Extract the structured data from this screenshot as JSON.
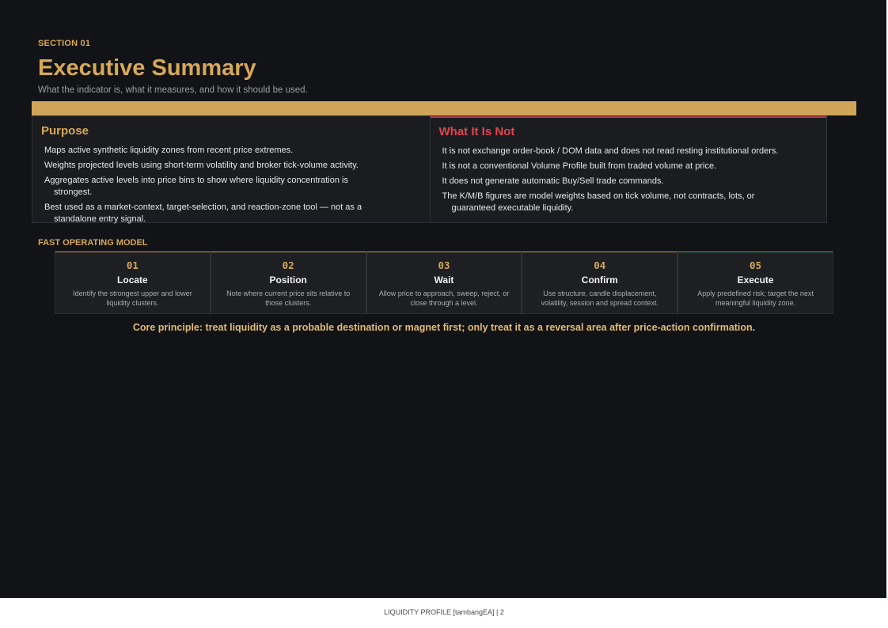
{
  "header": {
    "section_label": "SECTION 01",
    "title": "Executive Summary",
    "subtitle": "What the indicator is, what it measures, and how it should be used."
  },
  "purpose": {
    "title": "Purpose",
    "items": [
      "Maps active synthetic liquidity zones from recent price extremes.",
      "Weights projected levels using short-term volatility and broker tick-volume activity.",
      "Aggregates active levels into price bins to show where liquidity concentration is strongest.",
      "Best used as a market-context, target-selection, and reaction-zone tool — not as a standalone entry signal."
    ]
  },
  "not": {
    "title": "What It Is Not",
    "items": [
      "It is not exchange order-book / DOM data and does not read resting institutional orders.",
      "It is not a conventional Volume Profile built from traded volume at price.",
      "It does not generate automatic Buy/Sell trade commands.",
      "The K/M/B figures are model weights based on tick volume, not contracts, lots, or guaranteed executable liquidity."
    ]
  },
  "model": {
    "label": "FAST OPERATING MODEL",
    "steps": [
      {
        "num": "01",
        "title": "Locate",
        "desc": "Identify the strongest upper and lower liquidity clusters."
      },
      {
        "num": "02",
        "title": "Position",
        "desc": "Note where current price sits relative to those clusters."
      },
      {
        "num": "03",
        "title": "Wait",
        "desc": "Allow price to approach, sweep, reject, or close through a level."
      },
      {
        "num": "04",
        "title": "Confirm",
        "desc": "Use structure, candle displacement, volatility, session and spread context."
      },
      {
        "num": "05",
        "title": "Execute",
        "desc": "Apply predefined risk; target the next meaningful liquidity zone."
      }
    ]
  },
  "core_principle": "Core principle: treat liquidity as a probable destination or magnet first; only treat it as a reversal area after price-action confirmation.",
  "footer": "LIQUIDITY PROFILE [tambangEA]  |  2",
  "colors": {
    "accent_gold": "#d6a858",
    "accent_red": "#e2454f",
    "accent_green": "#3fae5c",
    "background": "#121316"
  }
}
